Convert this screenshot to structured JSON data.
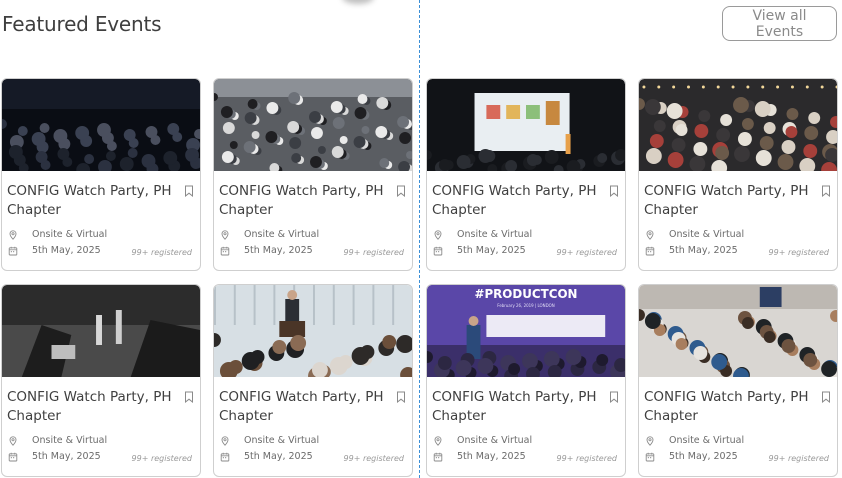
{
  "header": {
    "title": "Featured Events",
    "view_all_label": "View all Events"
  },
  "events": [
    {
      "name": "CONFIG Watch Party, PH Chapter",
      "location": "Onsite & Virtual",
      "date": "5th May, 2025",
      "registered": "99+ registered",
      "image": "dark-audience-photo"
    },
    {
      "name": "CONFIG Watch Party, PH Chapter",
      "location": "Onsite & Virtual",
      "date": "5th May, 2025",
      "registered": "99+ registered",
      "image": "crowd-aerial-photo"
    },
    {
      "name": "CONFIG Watch Party, PH Chapter",
      "location": "Onsite & Virtual",
      "date": "5th May, 2025",
      "registered": "99+ registered",
      "image": "projector-screen-photo"
    },
    {
      "name": "CONFIG Watch Party, PH Chapter",
      "location": "Onsite & Virtual",
      "date": "5th May, 2025",
      "registered": "99+ registered",
      "image": "party-crowd-photo"
    },
    {
      "name": "CONFIG Watch Party, PH Chapter",
      "location": "Onsite & Virtual",
      "date": "5th May, 2025",
      "registered": "99+ registered",
      "image": "bw-dinner-photo"
    },
    {
      "name": "CONFIG Watch Party, PH Chapter",
      "location": "Onsite & Virtual",
      "date": "5th May, 2025",
      "registered": "99+ registered",
      "image": "speaker-podium-photo"
    },
    {
      "name": "CONFIG Watch Party, PH Chapter",
      "location": "Onsite & Virtual",
      "date": "5th May, 2025",
      "registered": "99+ registered",
      "image": "productcon-stage-photo",
      "image_text": {
        "banner": "#PRODUCTCON",
        "sub": "February 26, 2019 | LONDON"
      }
    },
    {
      "name": "CONFIG Watch Party, PH Chapter",
      "location": "Onsite & Virtual",
      "date": "5th May, 2025",
      "registered": "99+ registered",
      "image": "seated-audience-photo"
    }
  ],
  "icons": {
    "location": "map-pin-icon",
    "date": "calendar-icon",
    "save": "bookmark-icon"
  },
  "colors": {
    "divider": "#3b8fd6",
    "card_border": "#cfcfcf",
    "button_border": "#9a9a9a"
  }
}
